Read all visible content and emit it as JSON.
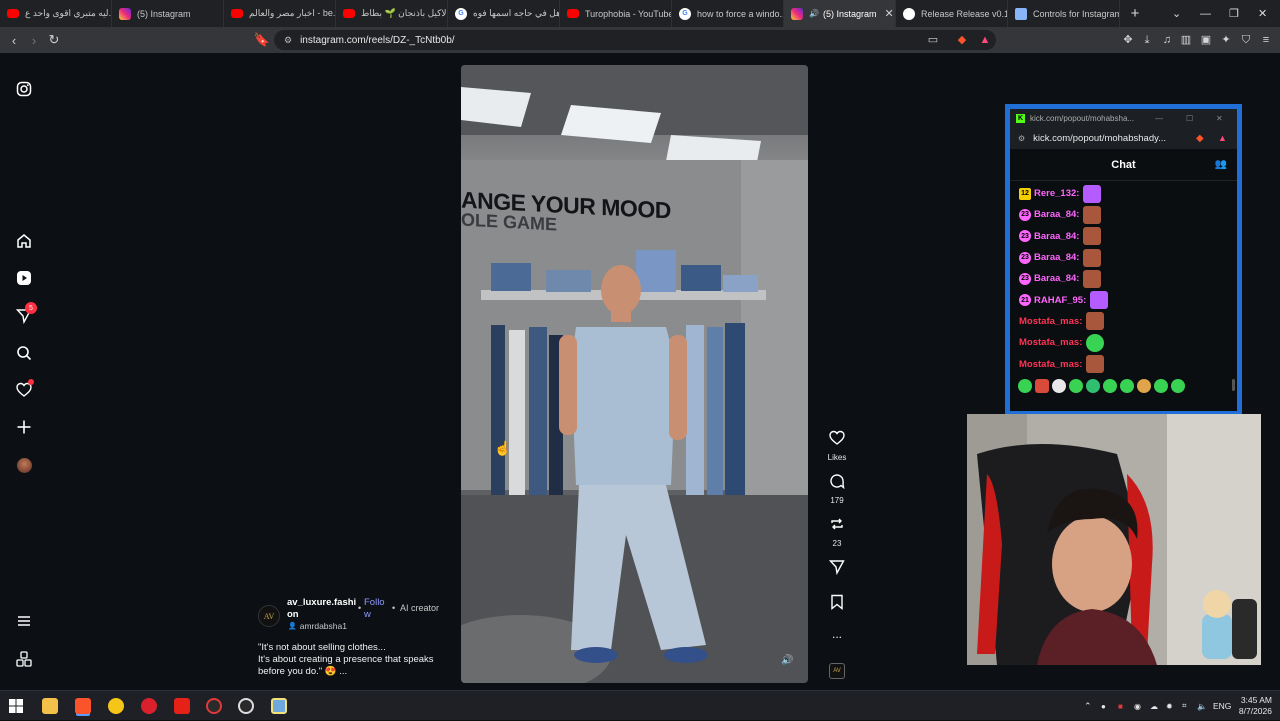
{
  "browser": {
    "tabs": [
      {
        "title": "ليه متبري اقوى واحد ع...",
        "favicon": "youtube",
        "active": false
      },
      {
        "title": "(5) Instagram",
        "favicon": "instagram",
        "active": false
      },
      {
        "title": "اخبار مصر والعالم - be...",
        "favicon": "youtube",
        "active": false
      },
      {
        "title": "الاكيل باذنجان 🌱 بطاط...",
        "favicon": "youtube",
        "active": false
      },
      {
        "title": "هل في حاجه اسمها فوه...",
        "favicon": "google",
        "active": false
      },
      {
        "title": "Turophobia - YouTube",
        "favicon": "youtube",
        "active": false
      },
      {
        "title": "how to force a windo...",
        "favicon": "google",
        "active": false
      },
      {
        "title": "(5) Instagram",
        "favicon": "instagram",
        "active": true
      },
      {
        "title": "Release Release v0.10",
        "favicon": "github",
        "active": false
      },
      {
        "title": "Controls for Instagram",
        "favicon": "doc",
        "active": false
      }
    ],
    "new_tab": "+",
    "url": "instagram.com/reels/DZ-_TcNtb0b/"
  },
  "reel": {
    "username": "av_luxure.fashion",
    "follow_label": "Follow",
    "ai_label": "AI creator",
    "audio_label": "amrdabsha1",
    "avatar_text": "AV",
    "caption_line1": "\"It's not about selling clothes...",
    "caption_line2": "It's about creating a presence that speaks",
    "caption_line3": "before you do.\" 😍 ...",
    "video_sign_line1": "ANGE YOUR MOOD",
    "video_sign_line2": "OLE GAME",
    "likes_label": "Likes",
    "comments_count": "179",
    "reposts_count": "23",
    "more_label": "..."
  },
  "sidebar": {
    "notifications_badge": "5"
  },
  "kick": {
    "title_url": "kick.com/popout/mohabsha...",
    "url": "kick.com/popout/mohabshady...",
    "chat_title": "Chat",
    "messages": [
      {
        "user": "Rere_132:",
        "badge": "12",
        "color": "#ff66ff",
        "badge_color": "#f5d000"
      },
      {
        "user": "Baraa_84:",
        "badge": "23",
        "color": "#ff66ff",
        "badge_color": "#ff66ff"
      },
      {
        "user": "Baraa_84:",
        "badge": "23",
        "color": "#ff66ff",
        "badge_color": "#ff66ff"
      },
      {
        "user": "Baraa_84:",
        "badge": "23",
        "color": "#ff66ff",
        "badge_color": "#ff66ff"
      },
      {
        "user": "Baraa_84:",
        "badge": "23",
        "color": "#ff66ff",
        "badge_color": "#ff66ff"
      },
      {
        "user": "RAHAF_95:",
        "badge": "21",
        "color": "#ff66ff",
        "badge_color": "#ff66ff"
      },
      {
        "user": "Mostafa_mas:",
        "badge": "",
        "color": "#ff3355",
        "badge_color": ""
      },
      {
        "user": "Mostafa_mas:",
        "badge": "",
        "color": "#ff3355",
        "badge_color": ""
      },
      {
        "user": "Mostafa_mas:",
        "badge": "",
        "color": "#ff3355",
        "badge_color": ""
      }
    ]
  },
  "taskbar": {
    "language": "ENG",
    "time": "3:45 AM",
    "date": "8/7/2026"
  },
  "colors": {
    "accent_link": "#8e9bff",
    "kick_border": "#1f6fd6",
    "notification": "#ff3040"
  }
}
